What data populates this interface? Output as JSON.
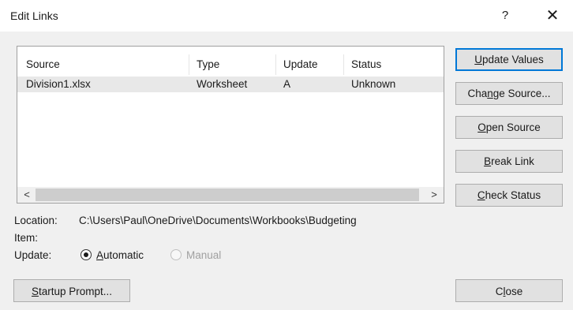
{
  "dialog": {
    "title": "Edit Links",
    "help_glyph": "?",
    "close_glyph": "✕"
  },
  "list": {
    "columns": [
      "Source",
      "Type",
      "Update",
      "Status"
    ],
    "rows": [
      {
        "source": "Division1.xlsx",
        "type": "Worksheet",
        "update": "A",
        "status": "Unknown"
      }
    ],
    "scroll_left": "<",
    "scroll_right": ">"
  },
  "buttons": {
    "update_values": {
      "before": "",
      "key": "U",
      "after": "pdate Values"
    },
    "change_source": {
      "before": "Cha",
      "key": "n",
      "after": "ge Source..."
    },
    "open_source": {
      "before": "",
      "key": "O",
      "after": "pen Source"
    },
    "break_link": {
      "before": "",
      "key": "B",
      "after": "reak Link"
    },
    "check_status": {
      "before": "",
      "key": "C",
      "after": "heck Status"
    },
    "startup_prompt": {
      "before": "",
      "key": "S",
      "after": "tartup Prompt..."
    },
    "close": {
      "before": "C",
      "key": "l",
      "after": "ose"
    }
  },
  "info": {
    "location_label": "Location:",
    "location_value": "C:\\Users\\Paul\\OneDrive\\Documents\\Workbooks\\Budgeting",
    "item_label": "Item:",
    "item_value": "",
    "update_label": "Update:",
    "automatic": {
      "key": "A",
      "after": "utomatic",
      "selected": true
    },
    "manual": {
      "label": "Manual",
      "selected": false,
      "disabled": true
    }
  }
}
